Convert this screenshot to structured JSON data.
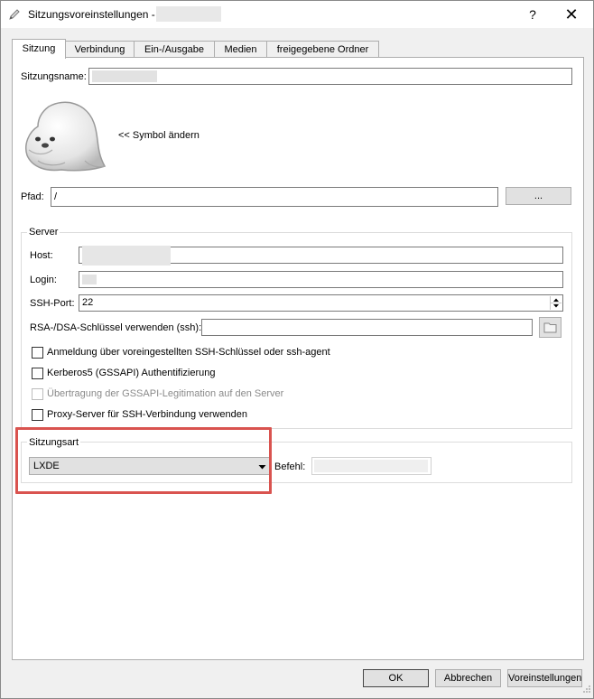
{
  "window": {
    "title": "Sitzungsvoreinstellungen -",
    "help_label": "?",
    "close_label": "✕"
  },
  "tabs": [
    {
      "label": "Sitzung"
    },
    {
      "label": "Verbindung"
    },
    {
      "label": "Ein-/Ausgabe"
    },
    {
      "label": "Medien"
    },
    {
      "label": "freigegebene Ordner"
    }
  ],
  "session": {
    "name_label": "Sitzungsname:",
    "icon_change_label": "<< Symbol ändern",
    "path_label": "Pfad:",
    "path_value": "/",
    "browse_label": "..."
  },
  "server": {
    "group_title": "Server",
    "host_label": "Host:",
    "login_label": "Login:",
    "ssh_port_label": "SSH-Port:",
    "ssh_port_value": "22",
    "rsa_label": "RSA-/DSA-Schlüssel verwenden (ssh):",
    "checkboxes": [
      {
        "label": "Anmeldung über voreingestellten SSH-Schlüssel oder ssh-agent",
        "checked": false,
        "enabled": true
      },
      {
        "label": "Kerberos5 (GSSAPI) Authentifizierung",
        "checked": false,
        "enabled": true
      },
      {
        "label": "Übertragung der GSSAPI-Legitimation auf den Server",
        "checked": false,
        "enabled": false
      },
      {
        "label": "Proxy-Server für SSH-Verbindung verwenden",
        "checked": false,
        "enabled": true
      }
    ]
  },
  "session_type": {
    "group_title": "Sitzungsart",
    "selected": "LXDE",
    "command_label": "Befehl:"
  },
  "footer": {
    "ok_label": "OK",
    "cancel_label": "Abbrechen",
    "defaults_label": "Voreinstellungen"
  },
  "colors": {
    "highlight_border": "#d9534f"
  }
}
